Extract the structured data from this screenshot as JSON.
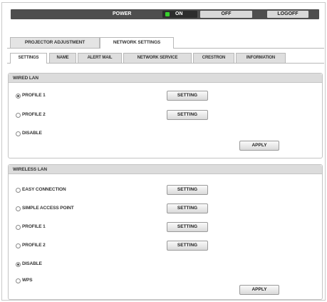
{
  "topbar": {
    "power_label": "POWER",
    "on_label": "ON",
    "off_label": "OFF",
    "logoff_label": "LOGOFF",
    "led_color": "#38d12d"
  },
  "main_tabs": [
    {
      "label": "PROJECTOR ADJUSTMENT",
      "active": false
    },
    {
      "label": "NETWORK SETTINGS",
      "active": true
    }
  ],
  "sub_tabs": [
    {
      "label": "SETTINGS",
      "active": true
    },
    {
      "label": "NAME",
      "active": false
    },
    {
      "label": "ALERT MAIL",
      "active": false
    },
    {
      "label": "NETWORK SERVICE",
      "active": false
    },
    {
      "label": "CRESTRON",
      "active": false
    },
    {
      "label": "INFORMATION",
      "active": false
    }
  ],
  "wired_lan": {
    "title": "WIRED LAN",
    "options": [
      {
        "label": "PROFILE 1",
        "selected": true,
        "button": "SETTING"
      },
      {
        "label": "PROFILE 2",
        "selected": false,
        "button": "SETTING"
      },
      {
        "label": "DISABLE",
        "selected": false
      }
    ],
    "apply_label": "APPLY"
  },
  "wireless_lan": {
    "title": "WIRELESS LAN",
    "options": [
      {
        "label": "EASY CONNECTION",
        "selected": false,
        "button": "SETTING"
      },
      {
        "label": "SIMPLE ACCESS POINT",
        "selected": false,
        "button": "SETTING"
      },
      {
        "label": "PROFILE 1",
        "selected": false,
        "button": "SETTING"
      },
      {
        "label": "PROFILE 2",
        "selected": false,
        "button": "SETTING"
      },
      {
        "label": "DISABLE",
        "selected": true
      },
      {
        "label": "WPS",
        "selected": false
      }
    ],
    "apply_label": "APPLY"
  }
}
